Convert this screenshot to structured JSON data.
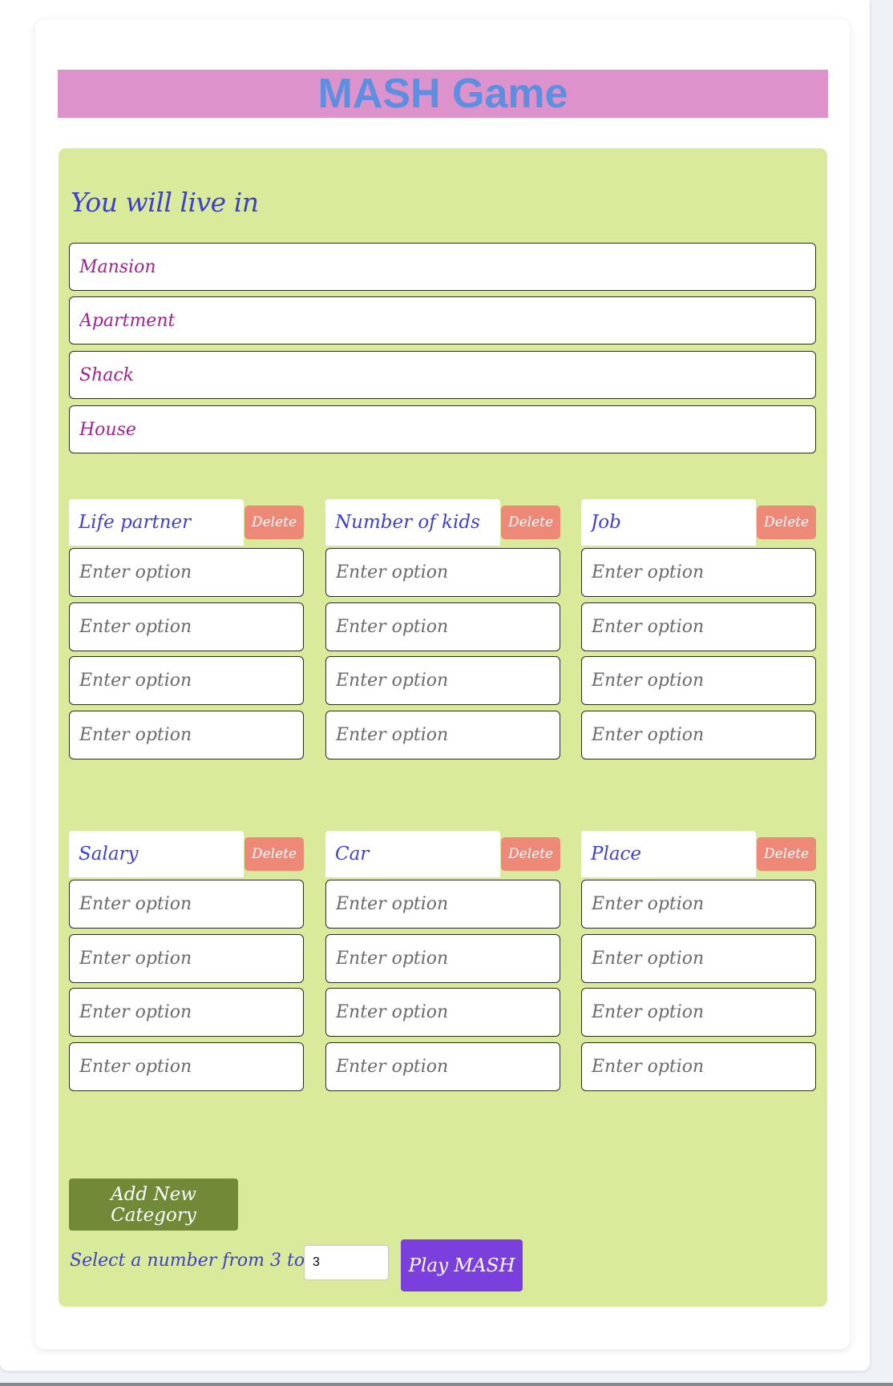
{
  "title": "MASH Game",
  "live": {
    "heading": "You will live in",
    "options": [
      "Mansion",
      "Apartment",
      "Shack",
      "House"
    ]
  },
  "categories": [
    {
      "name": "Life partner",
      "delete_label": "Delete",
      "placeholders": [
        "Enter option",
        "Enter option",
        "Enter option",
        "Enter option"
      ]
    },
    {
      "name": "Number of kids",
      "delete_label": "Delete",
      "placeholders": [
        "Enter option",
        "Enter option",
        "Enter option",
        "Enter option"
      ]
    },
    {
      "name": "Job",
      "delete_label": "Delete",
      "placeholders": [
        "Enter option",
        "Enter option",
        "Enter option",
        "Enter option"
      ]
    },
    {
      "name": "Salary",
      "delete_label": "Delete",
      "placeholders": [
        "Enter option",
        "Enter option",
        "Enter option",
        "Enter option"
      ]
    },
    {
      "name": "Car",
      "delete_label": "Delete",
      "placeholders": [
        "Enter option",
        "Enter option",
        "Enter option",
        "Enter option"
      ]
    },
    {
      "name": "Place",
      "delete_label": "Delete",
      "placeholders": [
        "Enter option",
        "Enter option",
        "Enter option",
        "Enter option"
      ]
    }
  ],
  "controls": {
    "add_category_label": "Add New Category",
    "select_label": "Select a number from 3 to 10:",
    "number_value": "3",
    "play_label": "Play MASH"
  },
  "colors": {
    "title_bg": "#de92cc",
    "title_text": "#5b8fdf",
    "panel_bg": "#d9ea9a",
    "heading_text": "#3f3fcf",
    "live_option_text": "#a0228f",
    "delete_button": "#ee8877",
    "add_button": "#728a38",
    "play_button": "#7a3fdc"
  }
}
